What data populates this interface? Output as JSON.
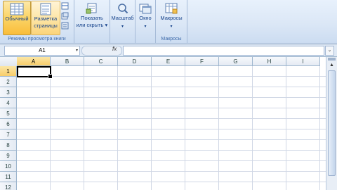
{
  "ribbon": {
    "view_group": {
      "label": "Режимы просмотра книги",
      "normal_label": "Обычный",
      "page_layout_label_1": "Разметка",
      "page_layout_label_2": "страницы"
    },
    "show_hide": {
      "label_1": "Показать",
      "label_2": "или скрыть",
      "arrow": "▾"
    },
    "zoom": {
      "label": "Масштаб",
      "arrow": "▾"
    },
    "window": {
      "label": "Окно",
      "arrow": "▾"
    },
    "macros": {
      "button_label": "Макросы",
      "arrow": "▾",
      "group_label": "Макросы"
    }
  },
  "formula_bar": {
    "name_box_value": "A1",
    "name_box_arrow": "▾",
    "fx_label": "fx",
    "formula_value": "",
    "expand_icon": "⌄"
  },
  "sheet": {
    "columns": [
      "A",
      "B",
      "C",
      "D",
      "E",
      "F",
      "G",
      "H",
      "I"
    ],
    "rows": [
      "1",
      "2",
      "3",
      "4",
      "5",
      "6",
      "7",
      "8",
      "9",
      "10",
      "11",
      "12"
    ],
    "active_cell": "A1"
  },
  "scrollbar": {
    "up_arrow": "▲"
  },
  "colors": {
    "ribbon_bg": "#dbe7f6",
    "active_button": "#f9bd3a",
    "grid_lines": "#d0d7e5",
    "header_bg": "#e4eaf3",
    "selected_header": "#f8cd6a"
  }
}
